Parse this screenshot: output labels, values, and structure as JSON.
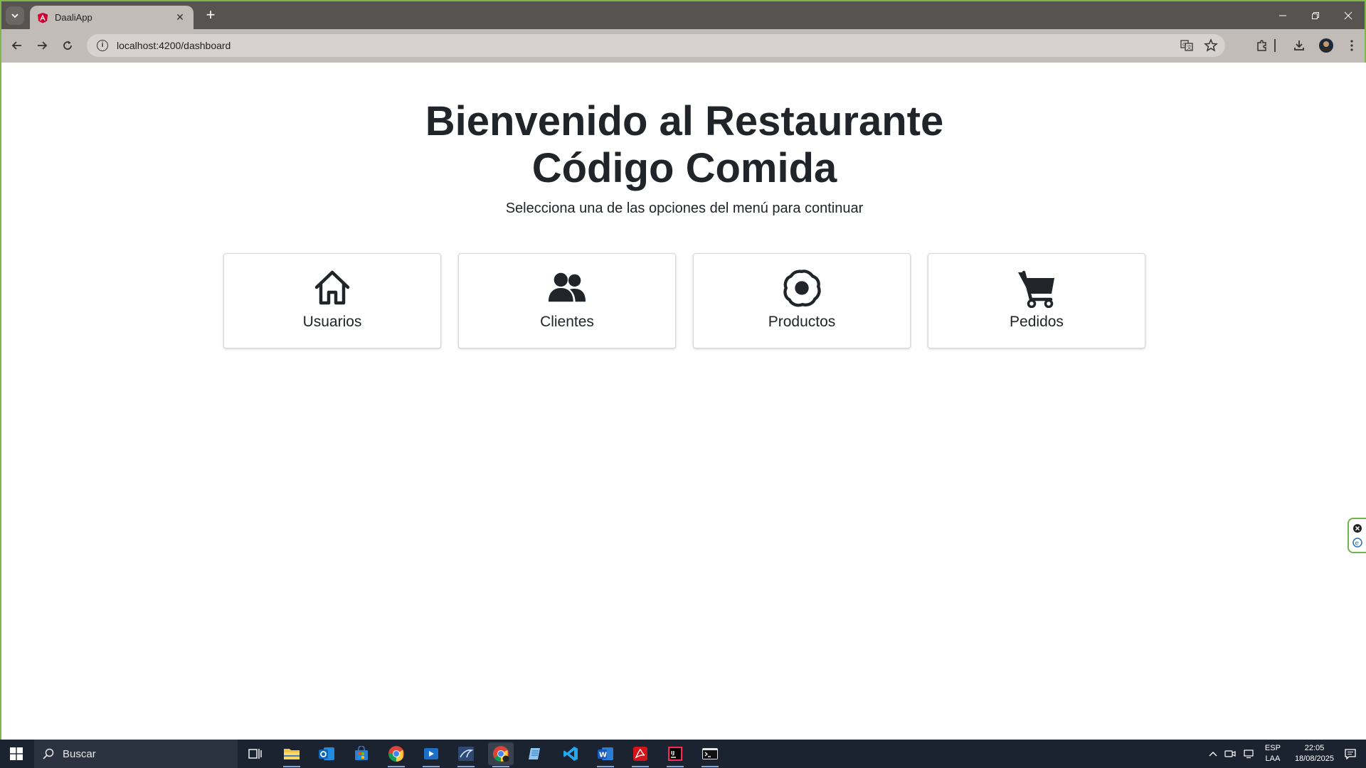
{
  "browser": {
    "tab_title": "DaaliApp",
    "url": "localhost:4200/dashboard"
  },
  "page": {
    "title_line1": "Bienvenido al Restaurante",
    "title_line2": "Código Comida",
    "subtitle": "Selecciona una de las opciones del menú para continuar",
    "cards": [
      {
        "label": "Usuarios",
        "icon": "house-icon"
      },
      {
        "label": "Clientes",
        "icon": "people-icon"
      },
      {
        "label": "Productos",
        "icon": "egg-icon"
      },
      {
        "label": "Pedidos",
        "icon": "cart-icon"
      }
    ]
  },
  "taskbar": {
    "search_placeholder": "Buscar",
    "lang_line1": "ESP",
    "lang_line2": "LAA",
    "time": "22:05",
    "date": "18/08/2025"
  },
  "colors": {
    "chrome_dark": "#575350",
    "chrome_light": "#c2bcb9",
    "text": "#212529",
    "taskbar": "#1c2330",
    "frame_accent": "#7db64a"
  }
}
